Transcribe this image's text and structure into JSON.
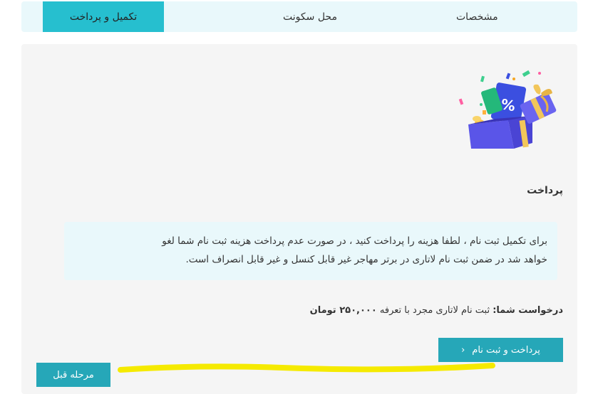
{
  "steps": [
    {
      "label": "مشخصات"
    },
    {
      "label": "محل سکونت"
    },
    {
      "label": "تکمیل و پرداخت"
    }
  ],
  "payment": {
    "title": "پرداخت",
    "notice_line1": "برای تکمیل ثبت نام ، لطفا هزینه را پرداخت کنید ، در صورت عدم پرداخت هزینه ثبت نام شما لغو",
    "notice_line2": "خواهد شد در ضمن ثبت نام لاتاری در برتر مهاجر غیر قابل کنسل و غیر قابل انصراف است.",
    "request_label": "درخواست شما:",
    "request_text": " ثبت نام لاتاری مجرد با تعرفه ",
    "request_price": "۲۵۰,۰۰۰ تومان",
    "pay_button": "پرداخت و ثبت نام",
    "prev_button": "مرحله قبل"
  },
  "colors": {
    "accent": "#26bfcf",
    "button": "#26a7b8",
    "notice_bg": "#e9f8fb",
    "highlight": "#f5ea00"
  },
  "icons": {
    "pay_chevron": "chevron-left-icon",
    "illustration": "gift-box-discount-illustration"
  }
}
